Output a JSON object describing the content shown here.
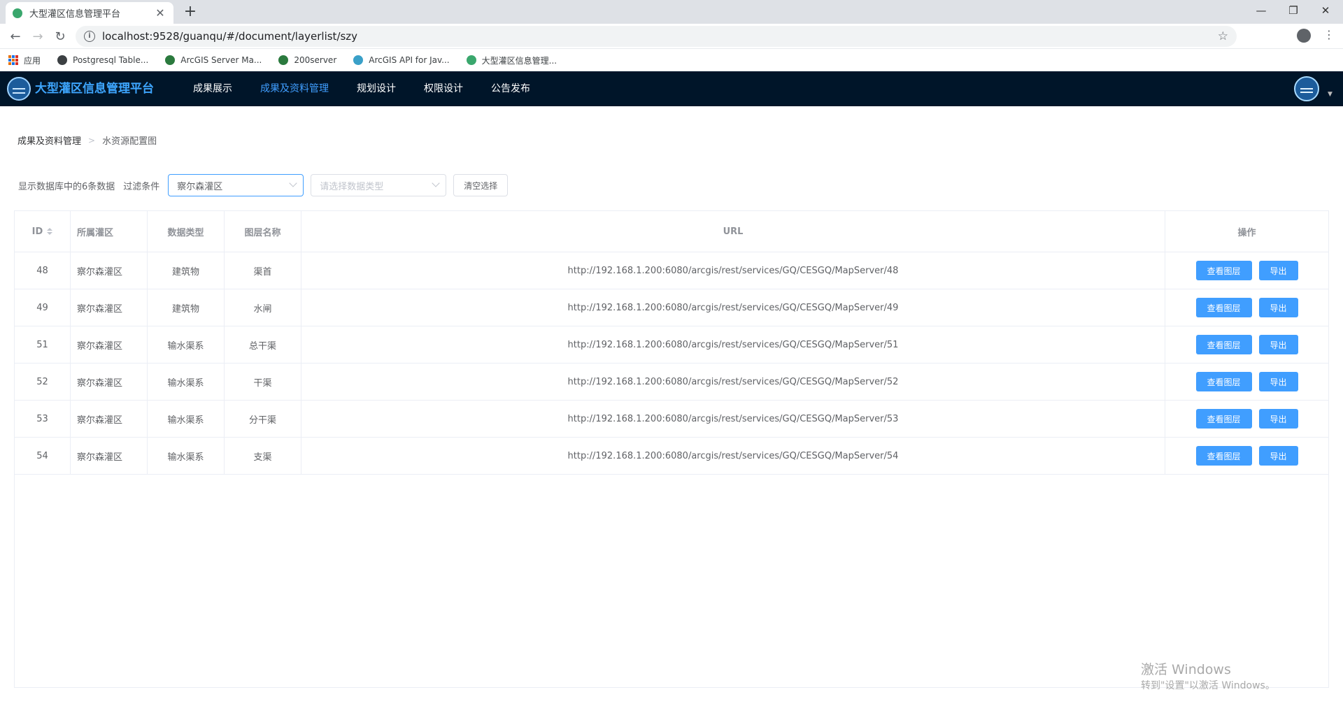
{
  "browser": {
    "tab_title": "大型灌区信息管理平台",
    "tab_close": "✕",
    "new_tab": "+",
    "url": "localhost:9528/guanqu/#/document/layerlist/szy",
    "window_controls": [
      "—",
      "❐",
      "✕"
    ],
    "bookmarks": [
      {
        "label": "应用",
        "icon": "apps-grid-icon"
      },
      {
        "label": "Postgresql Table...",
        "icon": "globe-icon",
        "color": "#3c4043"
      },
      {
        "label": "ArcGIS Server Ma...",
        "icon": "globe-icon",
        "color": "#2b7a3e"
      },
      {
        "label": "200server",
        "icon": "globe-icon",
        "color": "#2b7a3e"
      },
      {
        "label": "ArcGIS API for Jav...",
        "icon": "arcgis-icon",
        "color": "#3aa0c8"
      },
      {
        "label": "大型灌区信息管理...",
        "icon": "vue-icon",
        "color": "#3aa76d"
      }
    ]
  },
  "app": {
    "title": "大型灌区信息管理平台",
    "nav": [
      {
        "label": "成果展示",
        "active": false
      },
      {
        "label": "成果及资料管理",
        "active": true
      },
      {
        "label": "规划设计",
        "active": false
      },
      {
        "label": "权限设计",
        "active": false
      },
      {
        "label": "公告发布",
        "active": false
      }
    ],
    "colors": {
      "header_bg": "#001529",
      "accent": "#409eff"
    }
  },
  "breadcrumb": {
    "root": "成果及资料管理",
    "current": "水资源配置图"
  },
  "filter": {
    "count_text": "显示数据库中的6条数据",
    "condition_label": "过滤条件",
    "area_value": "察尔森灌区",
    "type_placeholder": "请选择数据类型",
    "clear_label": "清空选择"
  },
  "table": {
    "headers": {
      "id": "ID",
      "area": "所属灌区",
      "type": "数据类型",
      "name": "图层名称",
      "url": "URL",
      "op": "操作"
    },
    "view_label": "查看图层",
    "export_label": "导出",
    "rows": [
      {
        "id": "48",
        "area": "察尔森灌区",
        "type": "建筑物",
        "name": "渠首",
        "url": "http://192.168.1.200:6080/arcgis/rest/services/GQ/CESGQ/MapServer/48"
      },
      {
        "id": "49",
        "area": "察尔森灌区",
        "type": "建筑物",
        "name": "水闸",
        "url": "http://192.168.1.200:6080/arcgis/rest/services/GQ/CESGQ/MapServer/49"
      },
      {
        "id": "51",
        "area": "察尔森灌区",
        "type": "输水渠系",
        "name": "总干渠",
        "url": "http://192.168.1.200:6080/arcgis/rest/services/GQ/CESGQ/MapServer/51"
      },
      {
        "id": "52",
        "area": "察尔森灌区",
        "type": "输水渠系",
        "name": "干渠",
        "url": "http://192.168.1.200:6080/arcgis/rest/services/GQ/CESGQ/MapServer/52"
      },
      {
        "id": "53",
        "area": "察尔森灌区",
        "type": "输水渠系",
        "name": "分干渠",
        "url": "http://192.168.1.200:6080/arcgis/rest/services/GQ/CESGQ/MapServer/53"
      },
      {
        "id": "54",
        "area": "察尔森灌区",
        "type": "输水渠系",
        "name": "支渠",
        "url": "http://192.168.1.200:6080/arcgis/rest/services/GQ/CESGQ/MapServer/54"
      }
    ]
  },
  "watermark": {
    "line1": "激活 Windows",
    "line2": "转到\"设置\"以激活 Windows。"
  }
}
